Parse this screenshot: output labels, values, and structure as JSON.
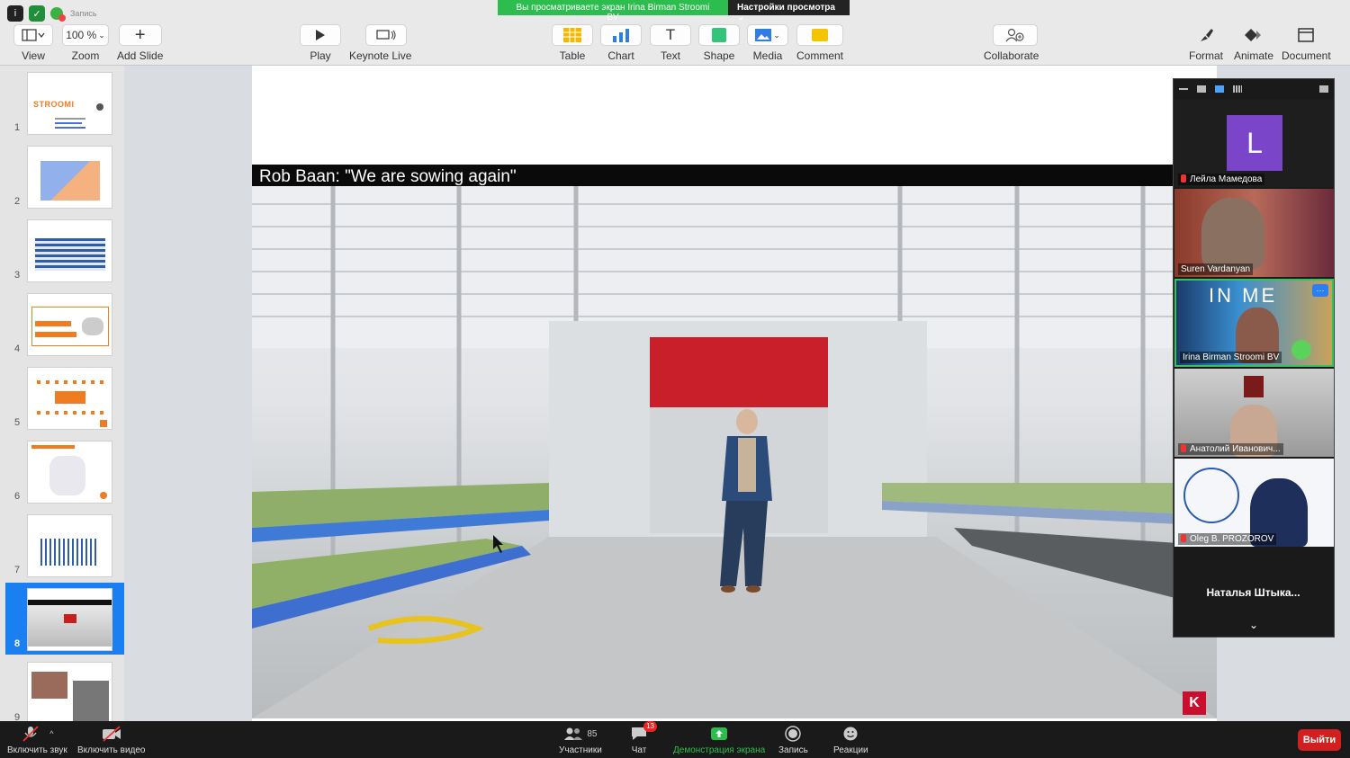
{
  "record_label": "Запись",
  "banner": {
    "viewing_text": "Вы просматриваете экран Irina Birman Stroomi BV",
    "view_options": "Настройки просмотра ⌄",
    "colors": {
      "green": "#2dbd4e",
      "dark": "#232323"
    }
  },
  "toolbar": {
    "view": {
      "label": "View",
      "icon": "sidebar-layout-icon"
    },
    "zoom": {
      "label": "Zoom",
      "value": "100 %"
    },
    "add_slide": {
      "label": "Add Slide",
      "icon": "plus-icon"
    },
    "play": {
      "label": "Play",
      "icon": "play-icon"
    },
    "keynote_live": {
      "label": "Keynote Live",
      "icon": "keynote-live-icon"
    },
    "table": {
      "label": "Table",
      "icon": "table-icon"
    },
    "chart": {
      "label": "Chart",
      "icon": "bar-chart-icon"
    },
    "text": {
      "label": "Text",
      "icon": "text-icon"
    },
    "shape": {
      "label": "Shape",
      "icon": "shape-icon"
    },
    "media": {
      "label": "Media",
      "icon": "image-icon"
    },
    "comment": {
      "label": "Comment",
      "icon": "comment-icon"
    },
    "collaborate": {
      "label": "Collaborate",
      "icon": "collaborate-icon"
    },
    "format": {
      "label": "Format",
      "icon": "paintbrush-icon"
    },
    "animate": {
      "label": "Animate",
      "icon": "diamond-icon"
    },
    "document": {
      "label": "Document",
      "icon": "document-icon"
    }
  },
  "navigator": {
    "selected_color": "#1a7ff0",
    "slides": [
      {
        "num": "1",
        "thumb_text": "STROOMI"
      },
      {
        "num": "2"
      },
      {
        "num": "3"
      },
      {
        "num": "4"
      },
      {
        "num": "5"
      },
      {
        "num": "6"
      },
      {
        "num": "7"
      },
      {
        "num": "8"
      },
      {
        "num": "9"
      }
    ],
    "selected": "8"
  },
  "slide": {
    "video_title": "Rob Baan: \"We are sowing again\"",
    "corner_logo": "K"
  },
  "participants": {
    "tiles": [
      {
        "name": "Лейла Мамедова",
        "avatar": "L",
        "muted": true
      },
      {
        "name": "Suren Vardanyan",
        "muted": false
      },
      {
        "name": "Irina Birman Stroomi BV",
        "muted": false,
        "bg_text": "IN ME"
      },
      {
        "name": "Анатолий Иванович...",
        "muted": true
      },
      {
        "name": "Oleg B. PROZOROV",
        "muted": true
      },
      {
        "name": "Наталья  Штыка...",
        "muted": false
      }
    ],
    "more": "···"
  },
  "bottombar": {
    "unmute": "Включить звук",
    "start_video": "Включить видео",
    "participants": "Участники",
    "participants_count": "85",
    "chat": "Чат",
    "chat_badge": "13",
    "share_screen": "Демонстрация экрана",
    "record": "Запись",
    "reactions": "Реакции",
    "leave": "Выйти",
    "leave_color": "#d21f1f",
    "share_color": "#2dbd4e"
  }
}
